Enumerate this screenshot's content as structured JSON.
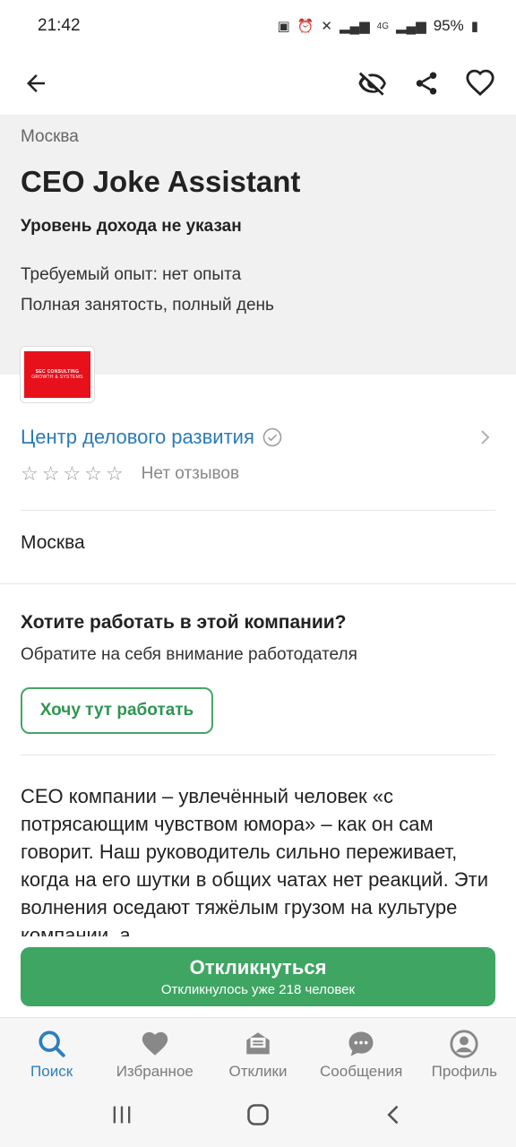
{
  "status_bar": {
    "time": "21:42",
    "network": "4G",
    "battery": "95%"
  },
  "app_bar": {
    "icons": [
      "back-arrow-icon",
      "eye-off-icon",
      "share-icon",
      "heart-icon"
    ]
  },
  "vacancy": {
    "city": "Москва",
    "title": "CEO Joke Assistant",
    "salary": "Уровень дохода не указан",
    "experience": "Требуемый опыт: нет опыта",
    "employment": "Полная занятость, полный день"
  },
  "company": {
    "logo_text_1": "SEC CONSULTING",
    "logo_text_2": "GROWTH & SYSTEMS",
    "name": "Центр делового развития",
    "rating_stars": 0,
    "reviews_label": "Нет отзывов",
    "location": "Москва"
  },
  "work_here": {
    "question": "Хотите работать в этой компании?",
    "subtitle": "Обратите на себя внимание работодателя",
    "button_label": "Хочу тут работать"
  },
  "description": "СЕО компании – увлечённый человек «с потрясающим чувством юмора» – как он сам говорит. Наш руководитель сильно переживает, когда на его шутки в общих чатах нет реакций. Эти волнения оседают тяжёлым грузом на культуре компании, а",
  "respond": {
    "title": "Откликнуться",
    "subtitle": "Откликнулось уже 218 человек"
  },
  "bottom_nav": {
    "items": [
      {
        "label": "Поиск",
        "icon": "search-icon",
        "active": true
      },
      {
        "label": "Избранное",
        "icon": "heart-icon",
        "active": false
      },
      {
        "label": "Отклики",
        "icon": "responses-icon",
        "active": false
      },
      {
        "label": "Сообщения",
        "icon": "chat-icon",
        "active": false
      },
      {
        "label": "Профиль",
        "icon": "profile-icon",
        "active": false
      }
    ]
  },
  "colors": {
    "accent_green": "#3ea562",
    "link_blue": "#2b7bb8",
    "active_nav_blue": "#2c7fbd",
    "logo_red": "#e8101a"
  }
}
